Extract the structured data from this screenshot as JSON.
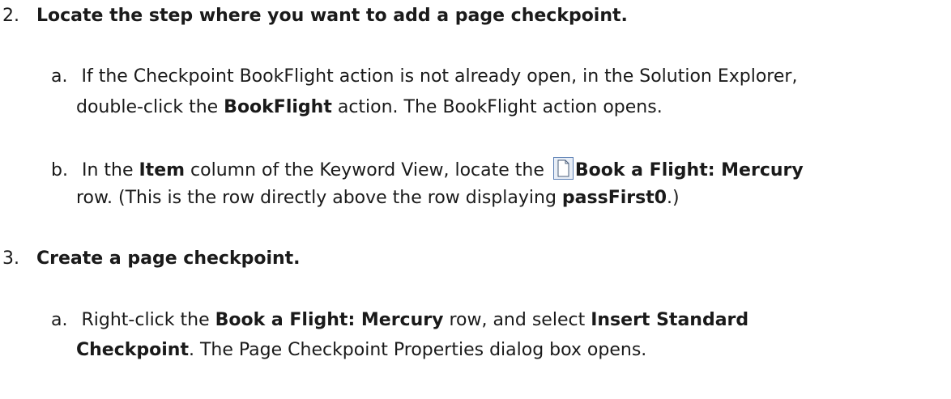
{
  "step2": {
    "number": "2.",
    "heading": "Locate the step where you want to add a page checkpoint.",
    "a": {
      "marker": "a.",
      "line1": "If the Checkpoint BookFlight action is not already open, in the Solution Explorer,",
      "line2_pre": "double-click the ",
      "line2_bold": "BookFlight",
      "line2_post": " action. The BookFlight action opens."
    },
    "b": {
      "marker": "b.",
      "l1_pre": "In the ",
      "l1_bold1": "Item",
      "l1_mid": " column of the Keyword View, locate the ",
      "icon": "page-icon",
      "l1_bold2": "Book a Flight: Mercury",
      "l2_pre": "row. (This is the row directly above the row displaying ",
      "l2_bold": "passFirst0",
      "l2_post": ".)"
    }
  },
  "step3": {
    "number": "3.",
    "heading": "Create a page checkpoint.",
    "a": {
      "marker": "a.",
      "l1_pre": "Right-click the ",
      "l1_bold1": "Book a Flight: Mercury",
      "l1_mid": " row, and select ",
      "l1_bold2": "Insert Standard",
      "l2_bold": "Checkpoint",
      "l2_post": ". The Page Checkpoint Properties dialog box opens."
    }
  }
}
